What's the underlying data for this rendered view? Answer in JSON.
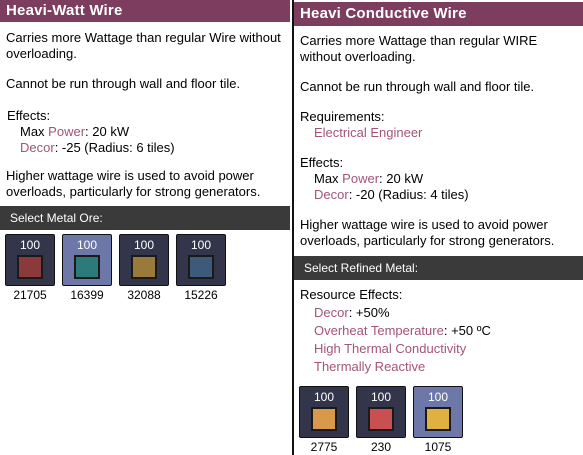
{
  "left": {
    "title": "Heavi-Watt Wire",
    "desc1": "Carries more Wattage than regular Wire without overloading.",
    "desc2": "Cannot be run through wall and floor tile.",
    "effects_label": "Effects:",
    "effect1_name": "Power",
    "effect1_prefix": "Max ",
    "effect1_value": ": 20 kW",
    "effect2_name": "Decor",
    "effect2_value": ": -25 (Radius: 6 tiles)",
    "desc3": "Higher wattage wire is used to avoid power overloads, particularly for strong generators.",
    "select_label": "Select Metal Ore:",
    "ores": [
      {
        "qty": "100",
        "count": "21705",
        "color": "#8a3a3a",
        "icon": "copper-ore-icon"
      },
      {
        "qty": "100",
        "count": "16399",
        "color": "#2d7a7a",
        "icon": "aluminum-ore-icon"
      },
      {
        "qty": "100",
        "count": "32088",
        "color": "#9a7a3a",
        "icon": "gold-amalgam-icon"
      },
      {
        "qty": "100",
        "count": "15226",
        "color": "#3d5a7a",
        "icon": "iron-ore-icon"
      }
    ]
  },
  "right": {
    "title": "Heavi Conductive Wire",
    "desc1": "Carries more Wattage than regular WIRE without overloading.",
    "desc2": "Cannot be run through wall and floor tile.",
    "req_label": "Requirements:",
    "req1": "Electrical Engineer",
    "effects_label": "Effects:",
    "effect1_prefix": "Max ",
    "effect1_name": "Power",
    "effect1_value": ": 20 kW",
    "effect2_name": "Decor",
    "effect2_value": ": -20 (Radius: 4 tiles)",
    "desc3": "Higher wattage wire is used to avoid power overloads, particularly for strong generators.",
    "select_label": "Select Refined Metal:",
    "res_label": "Resource Effects:",
    "res1_name": "Decor",
    "res1_value": ": +50%",
    "res2_name": "Overheat Temperature",
    "res2_value": ": +50 ºC",
    "res3": "High Thermal Conductivity",
    "res4": "Thermally Reactive",
    "metals": [
      {
        "qty": "100",
        "count": "2775",
        "color": "#d89a4a",
        "icon": "copper-bar-icon"
      },
      {
        "qty": "100",
        "count": "230",
        "color": "#c85050",
        "icon": "steel-bar-icon"
      },
      {
        "qty": "100",
        "count": "1075",
        "color": "#e0b040",
        "icon": "gold-bar-icon"
      }
    ]
  }
}
